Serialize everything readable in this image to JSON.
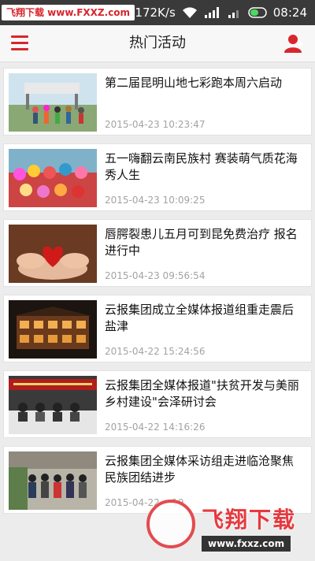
{
  "status_bar": {
    "watermark": "飞翔下载 www.FXXZ.com",
    "speed": "172K/s",
    "time": "08:24"
  },
  "header": {
    "title": "热门活动"
  },
  "articles": [
    {
      "title": "第二届昆明山地七彩跑本周六启动",
      "time": "2015-04-23 10:23:47"
    },
    {
      "title": "五一嗨翻云南民族村 赛装萌气质花海秀人生",
      "time": "2015-04-23 10:09:25"
    },
    {
      "title": "唇腭裂患儿五月可到昆免费治疗 报名进行中",
      "time": "2015-04-23 09:56:54"
    },
    {
      "title": "云报集团成立全媒体报道组重走震后盐津",
      "time": "2015-04-22 15:24:56"
    },
    {
      "title": "云报集团全媒体报道\"扶贫开发与美丽乡村建设\"会泽研讨会",
      "time": "2015-04-22 14:16:26"
    },
    {
      "title": "云报集团全媒体采访组走进临沧聚焦民族团结进步",
      "time": "2015-04-22 ..:19"
    }
  ],
  "watermark_overlay": {
    "text": "飞翔下载",
    "url": "www.fxxz.com"
  },
  "colors": {
    "accent": "#d8262c",
    "status_bar": "#3a3a3a"
  }
}
